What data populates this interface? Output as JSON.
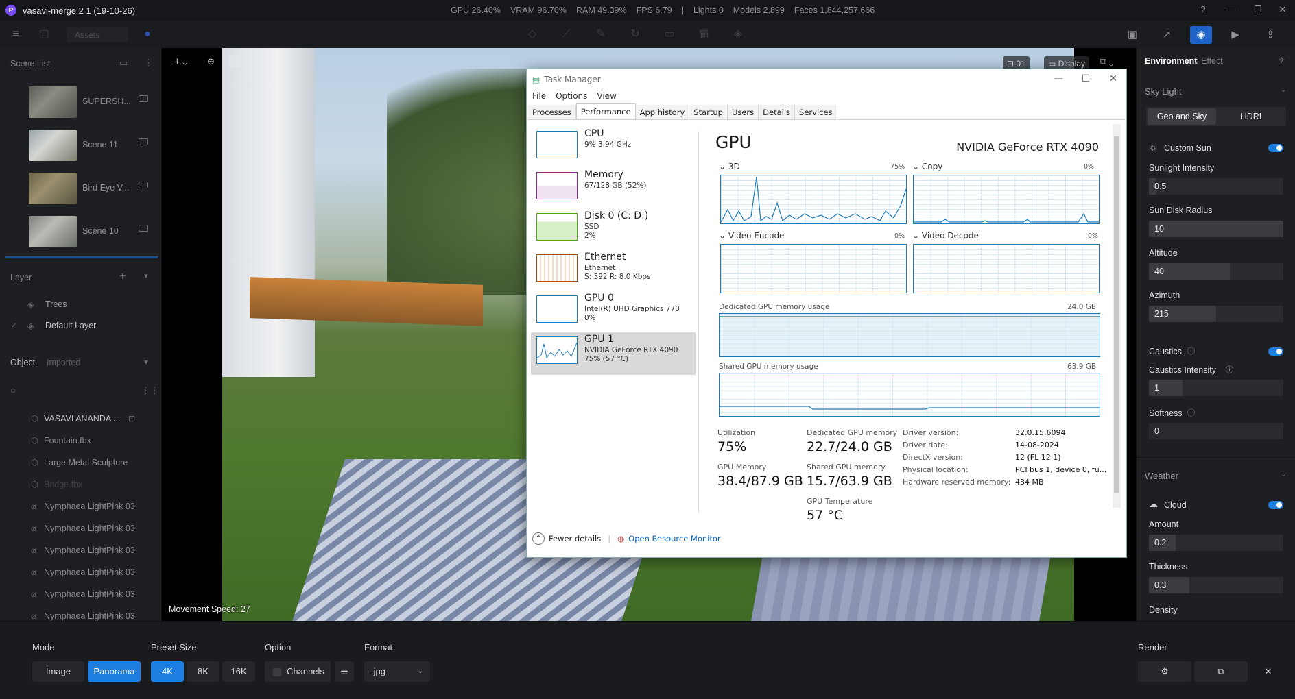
{
  "app": {
    "logo": "P",
    "title": "vasavi-merge 2 1 (19-10-26)"
  },
  "stats": {
    "gpu": "GPU 26.40%",
    "vram": "VRAM 96.70%",
    "ram": "RAM 49.39%",
    "fps": "FPS 6.79",
    "sep": "|",
    "lights": "Lights 0",
    "models": "Models 2,899",
    "faces": "Faces 1,844,257,666"
  },
  "toolbar": {
    "assets_label": "Assets"
  },
  "scene_list": {
    "header": "Scene List",
    "items": [
      {
        "label": "SUPERSH..."
      },
      {
        "label": "Scene 11"
      },
      {
        "label": "Bird Eye V..."
      },
      {
        "label": "Scene 10"
      }
    ]
  },
  "layer": {
    "header": "Layer",
    "items": [
      {
        "label": "Trees"
      },
      {
        "label": "Default Layer"
      }
    ]
  },
  "objects": {
    "tab_object": "Object",
    "tab_imported": "Imported",
    "items": [
      {
        "label": "VASAVI ANANDA ..."
      },
      {
        "label": "Fountain.fbx"
      },
      {
        "label": "Large Metal Sculpture"
      },
      {
        "label": "Bridge.fbx"
      },
      {
        "label": "Nymphaea LightPink 03"
      },
      {
        "label": "Nymphaea LightPink 03"
      },
      {
        "label": "Nymphaea LightPink 03"
      },
      {
        "label": "Nymphaea LightPink 03"
      },
      {
        "label": "Nymphaea LightPink 03"
      },
      {
        "label": "Nymphaea LightPink 03"
      }
    ]
  },
  "viewport": {
    "movement_speed": "Movement Speed: 27",
    "cam_label": "01",
    "display_label": "Display"
  },
  "task_manager": {
    "title": "Task Manager",
    "menu": [
      "File",
      "Options",
      "View"
    ],
    "tabs": [
      "Processes",
      "Performance",
      "App history",
      "Startup",
      "Users",
      "Details",
      "Services"
    ],
    "side": [
      {
        "name": "CPU",
        "sub1": "9% 3.94 GHz",
        "sub2": "",
        "sub3": "",
        "color": "#1e7bb8"
      },
      {
        "name": "Memory",
        "sub1": "67/128 GB (52%)",
        "sub2": "",
        "sub3": "",
        "color": "#8b2d8b"
      },
      {
        "name": "Disk 0 (C: D:)",
        "sub1": "SSD",
        "sub2": "2%",
        "sub3": "",
        "color": "#4da60c"
      },
      {
        "name": "Ethernet",
        "sub1": "Ethernet",
        "sub2": "S: 392 R: 8.0 Kbps",
        "sub3": "",
        "color": "#a74f01"
      },
      {
        "name": "GPU 0",
        "sub1": "Intel(R) UHD Graphics 770",
        "sub2": "0%",
        "sub3": "",
        "color": "#1e7bb8"
      },
      {
        "name": "GPU 1",
        "sub1": "NVIDIA GeForce RTX 4090",
        "sub2": "75% (57 °C)",
        "sub3": "",
        "color": "#1e7bb8"
      }
    ],
    "gpu_title": "GPU",
    "gpu_model": "NVIDIA GeForce RTX 4090",
    "engines": [
      {
        "name": "3D",
        "pct": "75%"
      },
      {
        "name": "Copy",
        "pct": "0%"
      },
      {
        "name": "Video Encode",
        "pct": "0%"
      },
      {
        "name": "Video Decode",
        "pct": "0%"
      }
    ],
    "dedicated_label": "Dedicated GPU memory usage",
    "dedicated_max": "24.0 GB",
    "shared_label": "Shared GPU memory usage",
    "shared_max": "63.9 GB",
    "stats": {
      "utilization_label": "Utilization",
      "utilization": "75%",
      "gpu_memory_label": "GPU Memory",
      "gpu_memory": "38.4/87.9 GB",
      "dedicated_label": "Dedicated GPU memory",
      "dedicated": "22.7/24.0 GB",
      "shared_label": "Shared GPU memory",
      "shared": "15.7/63.9 GB",
      "temp_label": "GPU Temperature",
      "temp": "57 °C"
    },
    "driver": [
      {
        "label": "Driver version:",
        "value": "32.0.15.6094"
      },
      {
        "label": "Driver date:",
        "value": "14-08-2024"
      },
      {
        "label": "DirectX version:",
        "value": "12 (FL 12.1)"
      },
      {
        "label": "Physical location:",
        "value": "PCI bus 1, device 0, fu..."
      },
      {
        "label": "Hardware reserved memory:",
        "value": "434 MB"
      }
    ],
    "fewer_details": "Fewer details",
    "open_monitor": "Open Resource Monitor"
  },
  "right_panel": {
    "tab_environment": "Environment",
    "tab_effect": "Effect",
    "sky_light": "Sky Light",
    "geo_sky": "Geo and Sky",
    "hdri": "HDRI",
    "custom_sun": "Custom Sun",
    "fields": [
      {
        "label": "Sunlight Intensity",
        "value": "0.5",
        "fill": 0.05
      },
      {
        "label": "Sun Disk Radius",
        "value": "10",
        "fill": 1.0
      },
      {
        "label": "Altitude",
        "value": "40",
        "fill": 0.6
      },
      {
        "label": "Azimuth",
        "value": "215",
        "fill": 0.5
      }
    ],
    "caustics": "Caustics",
    "caustics_fields": [
      {
        "label": "Caustics Intensity",
        "value": "1",
        "fill": 0.25
      },
      {
        "label": "Softness",
        "value": "0",
        "fill": 0.0
      }
    ],
    "weather": "Weather",
    "cloud": "Cloud",
    "cloud_fields": [
      {
        "label": "Amount",
        "value": "0.2",
        "fill": 0.2
      },
      {
        "label": "Thickness",
        "value": "0.3",
        "fill": 0.3
      }
    ],
    "density": "Density"
  },
  "bottom": {
    "mode_label": "Mode",
    "mode_image": "Image",
    "mode_panorama": "Panorama",
    "preset_label": "Preset Size",
    "size_4k": "4K",
    "size_8k": "8K",
    "size_16k": "16K",
    "option_label": "Option",
    "channels": "Channels",
    "format_label": "Format",
    "format_value": ".jpg",
    "render_label": "Render"
  },
  "colors": {
    "accent": "#1e7de0"
  }
}
